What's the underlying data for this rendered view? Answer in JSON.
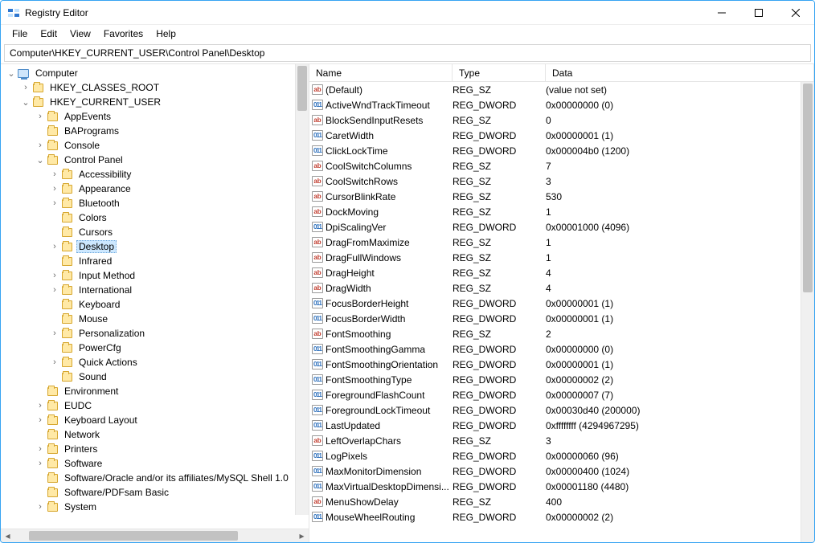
{
  "window": {
    "title": "Registry Editor"
  },
  "menu": [
    "File",
    "Edit",
    "View",
    "Favorites",
    "Help"
  ],
  "address": "Computer\\HKEY_CURRENT_USER\\Control Panel\\Desktop",
  "columns": {
    "name": "Name",
    "type": "Type",
    "data": "Data"
  },
  "tree": [
    {
      "depth": 0,
      "expand": "open",
      "icon": "computer",
      "label": "Computer"
    },
    {
      "depth": 1,
      "expand": "closed",
      "icon": "folder",
      "label": "HKEY_CLASSES_ROOT"
    },
    {
      "depth": 1,
      "expand": "open",
      "icon": "folder",
      "label": "HKEY_CURRENT_USER"
    },
    {
      "depth": 2,
      "expand": "closed",
      "icon": "folder",
      "label": "AppEvents"
    },
    {
      "depth": 2,
      "expand": "none",
      "icon": "folder",
      "label": "BAPrograms"
    },
    {
      "depth": 2,
      "expand": "closed",
      "icon": "folder",
      "label": "Console"
    },
    {
      "depth": 2,
      "expand": "open",
      "icon": "folder",
      "label": "Control Panel"
    },
    {
      "depth": 3,
      "expand": "closed",
      "icon": "folder",
      "label": "Accessibility"
    },
    {
      "depth": 3,
      "expand": "closed",
      "icon": "folder",
      "label": "Appearance"
    },
    {
      "depth": 3,
      "expand": "closed",
      "icon": "folder",
      "label": "Bluetooth"
    },
    {
      "depth": 3,
      "expand": "none",
      "icon": "folder",
      "label": "Colors"
    },
    {
      "depth": 3,
      "expand": "none",
      "icon": "folder",
      "label": "Cursors"
    },
    {
      "depth": 3,
      "expand": "closed",
      "icon": "folder",
      "label": "Desktop",
      "selected": true
    },
    {
      "depth": 3,
      "expand": "none",
      "icon": "folder",
      "label": "Infrared"
    },
    {
      "depth": 3,
      "expand": "closed",
      "icon": "folder",
      "label": "Input Method"
    },
    {
      "depth": 3,
      "expand": "closed",
      "icon": "folder",
      "label": "International"
    },
    {
      "depth": 3,
      "expand": "none",
      "icon": "folder",
      "label": "Keyboard"
    },
    {
      "depth": 3,
      "expand": "none",
      "icon": "folder",
      "label": "Mouse"
    },
    {
      "depth": 3,
      "expand": "closed",
      "icon": "folder",
      "label": "Personalization"
    },
    {
      "depth": 3,
      "expand": "none",
      "icon": "folder",
      "label": "PowerCfg"
    },
    {
      "depth": 3,
      "expand": "closed",
      "icon": "folder",
      "label": "Quick Actions"
    },
    {
      "depth": 3,
      "expand": "none",
      "icon": "folder",
      "label": "Sound"
    },
    {
      "depth": 2,
      "expand": "none",
      "icon": "folder",
      "label": "Environment"
    },
    {
      "depth": 2,
      "expand": "closed",
      "icon": "folder",
      "label": "EUDC"
    },
    {
      "depth": 2,
      "expand": "closed",
      "icon": "folder",
      "label": "Keyboard Layout"
    },
    {
      "depth": 2,
      "expand": "none",
      "icon": "folder",
      "label": "Network"
    },
    {
      "depth": 2,
      "expand": "closed",
      "icon": "folder",
      "label": "Printers"
    },
    {
      "depth": 2,
      "expand": "closed",
      "icon": "folder",
      "label": "Software"
    },
    {
      "depth": 2,
      "expand": "none",
      "icon": "folder",
      "label": "Software/Oracle and/or its affiliates/MySQL Shell 1.0"
    },
    {
      "depth": 2,
      "expand": "none",
      "icon": "folder",
      "label": "Software/PDFsam Basic"
    },
    {
      "depth": 2,
      "expand": "closed",
      "icon": "folder",
      "label": "System"
    }
  ],
  "values": [
    {
      "icon": "sz",
      "name": "(Default)",
      "type": "REG_SZ",
      "data": "(value not set)"
    },
    {
      "icon": "dw",
      "name": "ActiveWndTrackTimeout",
      "type": "REG_DWORD",
      "data": "0x00000000 (0)"
    },
    {
      "icon": "sz",
      "name": "BlockSendInputResets",
      "type": "REG_SZ",
      "data": "0"
    },
    {
      "icon": "dw",
      "name": "CaretWidth",
      "type": "REG_DWORD",
      "data": "0x00000001 (1)"
    },
    {
      "icon": "dw",
      "name": "ClickLockTime",
      "type": "REG_DWORD",
      "data": "0x000004b0 (1200)"
    },
    {
      "icon": "sz",
      "name": "CoolSwitchColumns",
      "type": "REG_SZ",
      "data": "7"
    },
    {
      "icon": "sz",
      "name": "CoolSwitchRows",
      "type": "REG_SZ",
      "data": "3"
    },
    {
      "icon": "sz",
      "name": "CursorBlinkRate",
      "type": "REG_SZ",
      "data": "530"
    },
    {
      "icon": "sz",
      "name": "DockMoving",
      "type": "REG_SZ",
      "data": "1"
    },
    {
      "icon": "dw",
      "name": "DpiScalingVer",
      "type": "REG_DWORD",
      "data": "0x00001000 (4096)"
    },
    {
      "icon": "sz",
      "name": "DragFromMaximize",
      "type": "REG_SZ",
      "data": "1"
    },
    {
      "icon": "sz",
      "name": "DragFullWindows",
      "type": "REG_SZ",
      "data": "1"
    },
    {
      "icon": "sz",
      "name": "DragHeight",
      "type": "REG_SZ",
      "data": "4"
    },
    {
      "icon": "sz",
      "name": "DragWidth",
      "type": "REG_SZ",
      "data": "4"
    },
    {
      "icon": "dw",
      "name": "FocusBorderHeight",
      "type": "REG_DWORD",
      "data": "0x00000001 (1)"
    },
    {
      "icon": "dw",
      "name": "FocusBorderWidth",
      "type": "REG_DWORD",
      "data": "0x00000001 (1)"
    },
    {
      "icon": "sz",
      "name": "FontSmoothing",
      "type": "REG_SZ",
      "data": "2"
    },
    {
      "icon": "dw",
      "name": "FontSmoothingGamma",
      "type": "REG_DWORD",
      "data": "0x00000000 (0)"
    },
    {
      "icon": "dw",
      "name": "FontSmoothingOrientation",
      "type": "REG_DWORD",
      "data": "0x00000001 (1)"
    },
    {
      "icon": "dw",
      "name": "FontSmoothingType",
      "type": "REG_DWORD",
      "data": "0x00000002 (2)"
    },
    {
      "icon": "dw",
      "name": "ForegroundFlashCount",
      "type": "REG_DWORD",
      "data": "0x00000007 (7)"
    },
    {
      "icon": "dw",
      "name": "ForegroundLockTimeout",
      "type": "REG_DWORD",
      "data": "0x00030d40 (200000)"
    },
    {
      "icon": "dw",
      "name": "LastUpdated",
      "type": "REG_DWORD",
      "data": "0xffffffff (4294967295)"
    },
    {
      "icon": "sz",
      "name": "LeftOverlapChars",
      "type": "REG_SZ",
      "data": "3"
    },
    {
      "icon": "dw",
      "name": "LogPixels",
      "type": "REG_DWORD",
      "data": "0x00000060 (96)"
    },
    {
      "icon": "dw",
      "name": "MaxMonitorDimension",
      "type": "REG_DWORD",
      "data": "0x00000400 (1024)"
    },
    {
      "icon": "dw",
      "name": "MaxVirtualDesktopDimensi...",
      "type": "REG_DWORD",
      "data": "0x00001180 (4480)"
    },
    {
      "icon": "sz",
      "name": "MenuShowDelay",
      "type": "REG_SZ",
      "data": "400"
    },
    {
      "icon": "dw",
      "name": "MouseWheelRouting",
      "type": "REG_DWORD",
      "data": "0x00000002 (2)"
    }
  ]
}
